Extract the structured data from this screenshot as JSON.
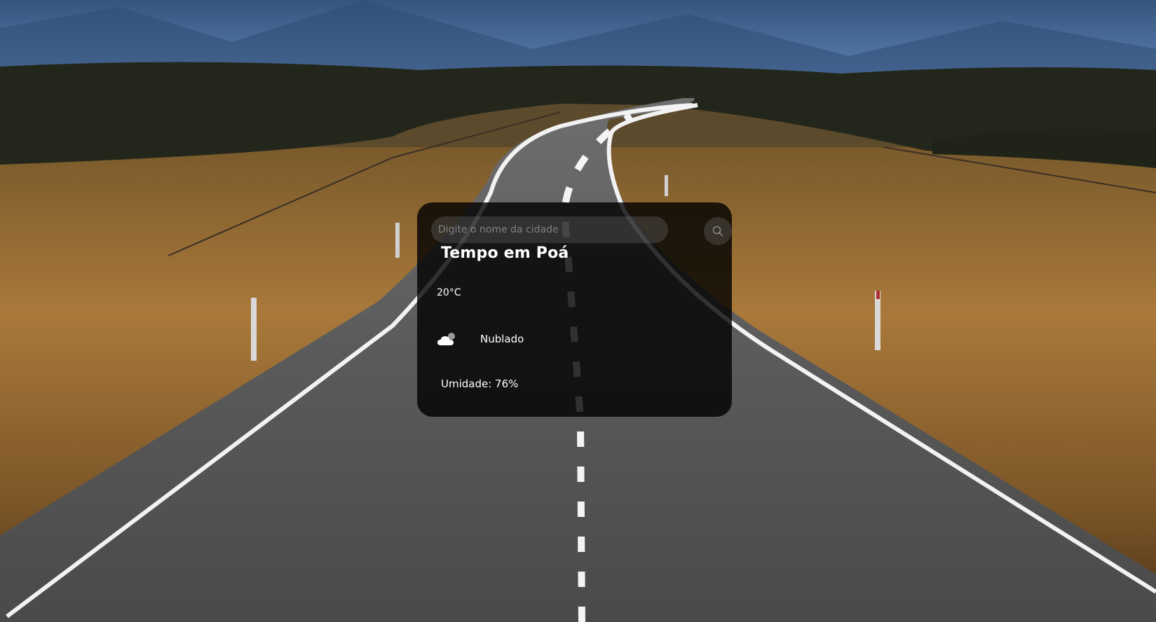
{
  "search": {
    "placeholder": "Digite o nome da cidade",
    "value": "",
    "button_icon": "search-icon"
  },
  "weather": {
    "title": "Tempo em Poá",
    "temperature": "20°C",
    "condition_icon": "cloud-icon",
    "condition": "Nublado",
    "humidity": "Umidade: 76%"
  },
  "colors": {
    "card_background": "#000000cc",
    "text": "#ffffff"
  }
}
